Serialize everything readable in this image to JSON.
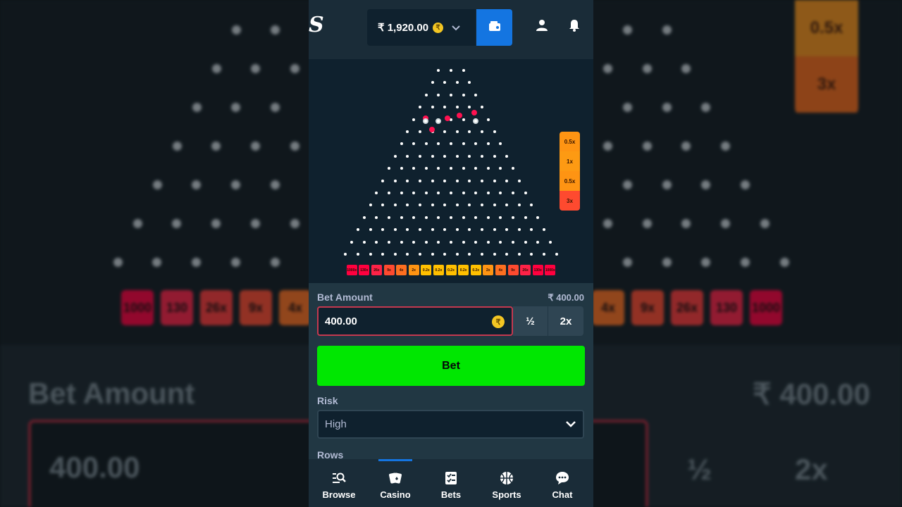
{
  "header": {
    "logo": "S",
    "balance": "₹ 1,920.00",
    "currency_symbol": "₹"
  },
  "game": {
    "rows": 16,
    "multipliers": [
      "1000x",
      "130x",
      "26x",
      "9x",
      "4x",
      "2x",
      "0.2x",
      "0.2x",
      "0.2x",
      "0.2x",
      "0.2x",
      "2x",
      "4x",
      "9x",
      "26x",
      "130x",
      "1000x"
    ],
    "history": [
      "0.5x",
      "1x",
      "0.5x",
      "3x"
    ]
  },
  "controls": {
    "bet_amount_label": "Bet Amount",
    "bet_amount_display": "₹ 400.00",
    "bet_amount_value": "400.00",
    "half_label": "½",
    "double_label": "2x",
    "bet_button": "Bet",
    "risk_label": "Risk",
    "risk_value": "High",
    "rows_label": "Rows"
  },
  "nav": [
    {
      "label": "Browse",
      "icon": "browse-icon"
    },
    {
      "label": "Casino",
      "icon": "casino-icon"
    },
    {
      "label": "Bets",
      "icon": "bets-icon"
    },
    {
      "label": "Sports",
      "icon": "sports-icon"
    },
    {
      "label": "Chat",
      "icon": "chat-icon"
    }
  ],
  "backdrop": {
    "bet_amount_label": "Bet Amount",
    "bet_amount_display": "₹ 400.00",
    "bet_amount_value": "400.00",
    "half_label": "½",
    "double_label": "2x",
    "slots_left": [
      "1000",
      "130",
      "26x",
      "9x",
      "4x"
    ],
    "slots_right": [
      "4x",
      "9x",
      "26x",
      "130",
      "1000"
    ],
    "side": [
      "0.5x",
      "3x"
    ]
  },
  "colors": {
    "accent_blue": "#1475e1",
    "bet_green": "#00e701",
    "input_border": "#c4384f"
  }
}
